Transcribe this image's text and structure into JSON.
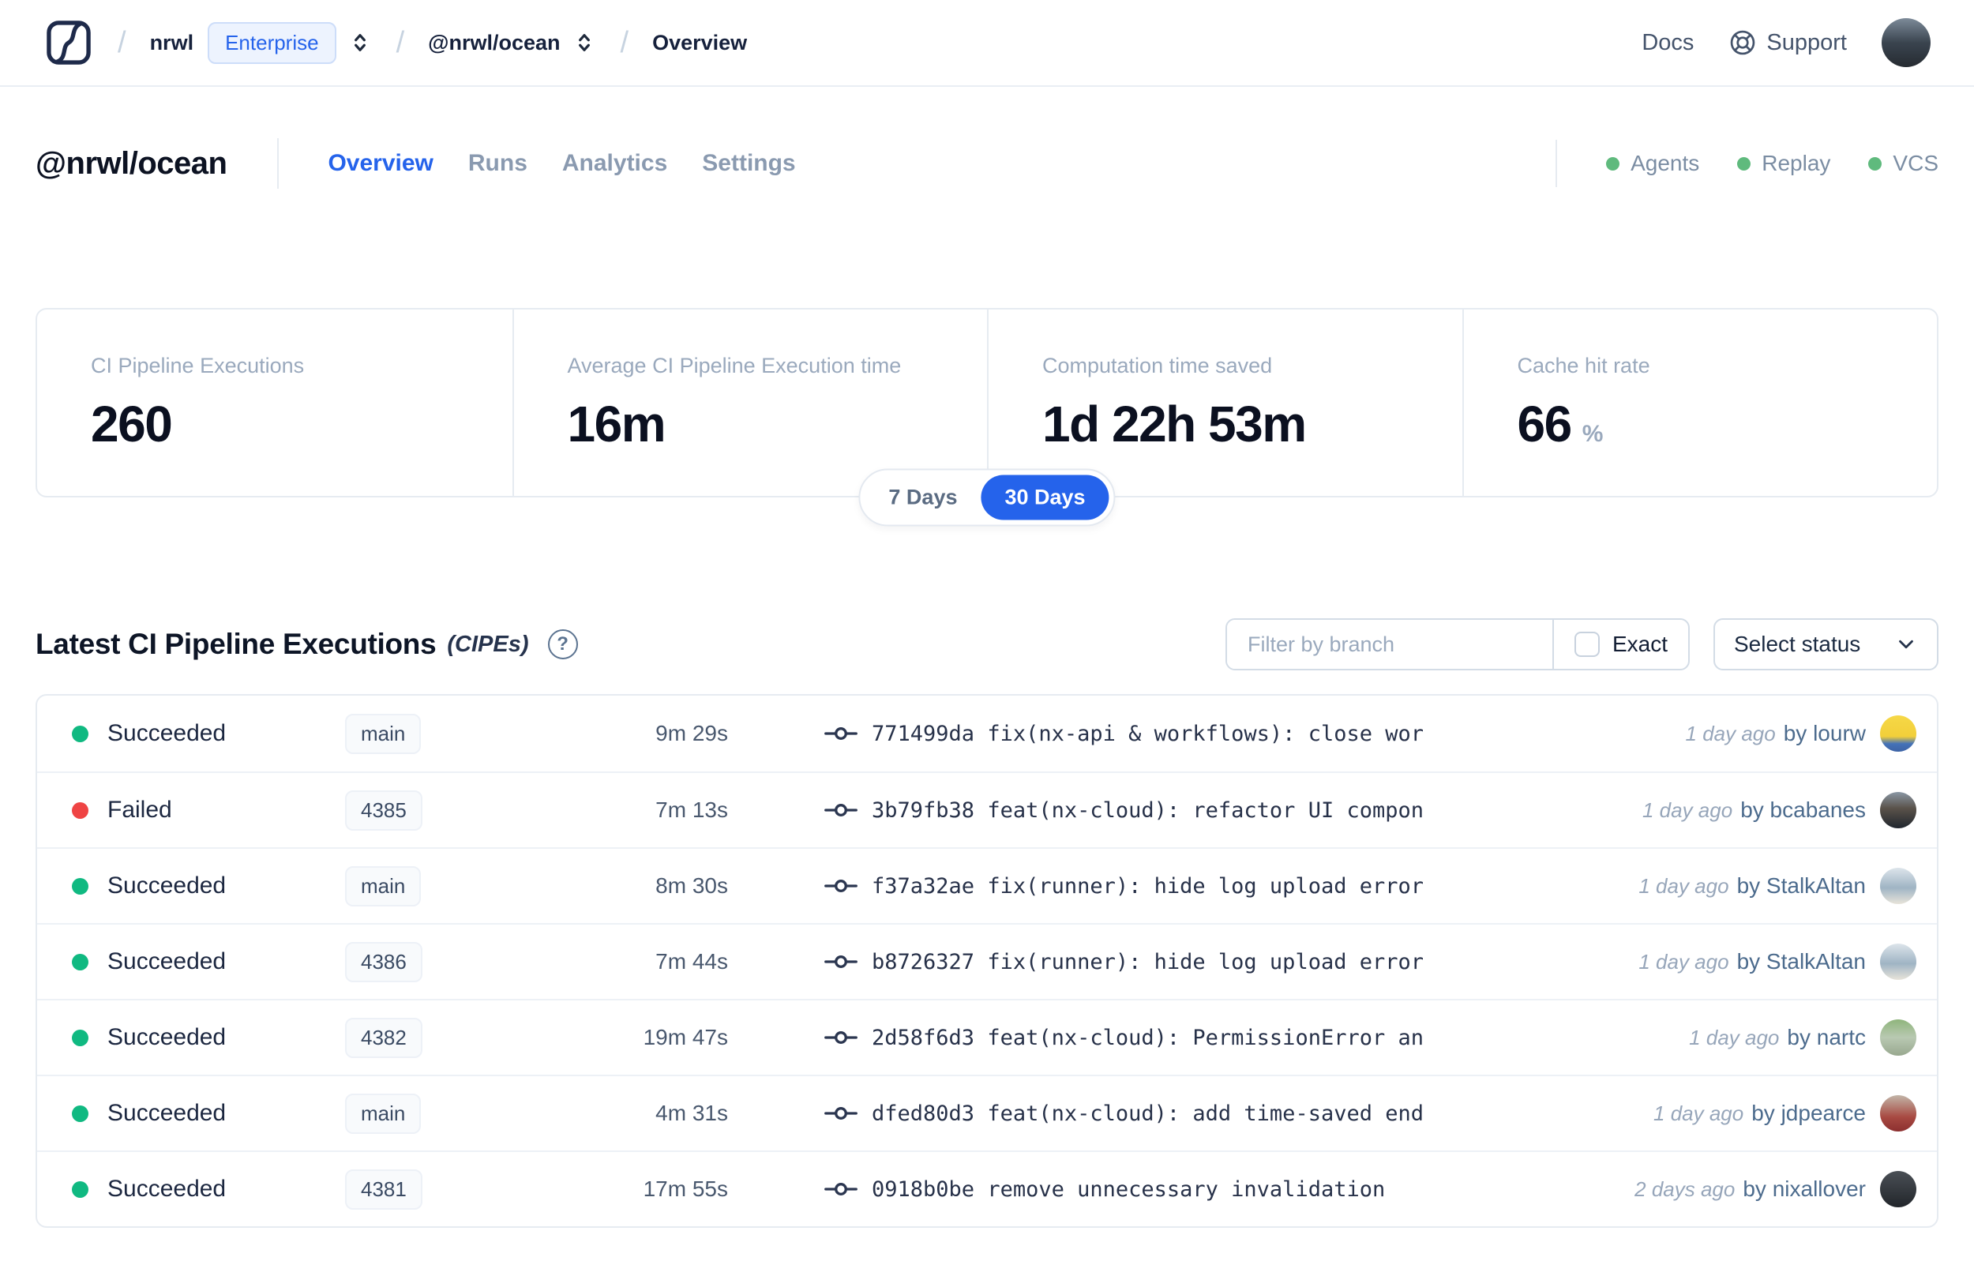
{
  "navbar": {
    "breadcrumb": {
      "org": "nrwl",
      "org_badge": "Enterprise",
      "workspace": "@nrwl/ocean",
      "page": "Overview"
    },
    "docs_label": "Docs",
    "support_label": "Support",
    "avatar_gradient": "linear-gradient(180deg,#7d8b99 0%,#3a444f 50%,#262b31 100%)"
  },
  "header": {
    "title": "@nrwl/ocean",
    "tabs": [
      {
        "label": "Overview",
        "active": true
      },
      {
        "label": "Runs",
        "active": false
      },
      {
        "label": "Analytics",
        "active": false
      },
      {
        "label": "Settings",
        "active": false
      }
    ],
    "services": [
      {
        "label": "Agents"
      },
      {
        "label": "Replay"
      },
      {
        "label": "VCS"
      }
    ],
    "service_dot_color": "#5fba7d"
  },
  "stats": {
    "cards": [
      {
        "label": "CI Pipeline Executions",
        "value": "260",
        "suffix": ""
      },
      {
        "label": "Average CI Pipeline Execution time",
        "value": "16m",
        "suffix": ""
      },
      {
        "label": "Computation time saved",
        "value": "1d 22h 53m",
        "suffix": ""
      },
      {
        "label": "Cache hit rate",
        "value": "66",
        "suffix": "%"
      }
    ],
    "range_toggle": {
      "options": [
        {
          "label": "7 Days"
        },
        {
          "label": "30 Days"
        }
      ],
      "selected": "30 Days"
    }
  },
  "cipe_section": {
    "title": "Latest CI Pipeline Executions",
    "title_suffix": "(CIPEs)",
    "help_glyph": "?",
    "filter": {
      "placeholder": "Filter by branch",
      "value": "",
      "exact_label": "Exact",
      "exact_checked": false
    },
    "status_select_label": "Select status"
  },
  "table": {
    "rows": [
      {
        "status": "Succeeded",
        "dot_color": "#10b981",
        "branch": "main",
        "duration": "9m 29s",
        "hash": "771499da",
        "message": "fix(nx-api & workflows): close workfl…",
        "time_ago": "1 day ago",
        "author": "by lourw",
        "avatar_gradient": "linear-gradient(180deg,#f6d847 0%,#f2cf3a 58%,#4472b8 78%,#3d63a5 100%)"
      },
      {
        "status": "Failed",
        "dot_color": "#ef4444",
        "branch": "4385",
        "duration": "7m 13s",
        "hash": "3b79fb38",
        "message": "feat(nx-cloud): refactor UI component…",
        "time_ago": "1 day ago",
        "author": "by bcabanes",
        "avatar_gradient": "linear-gradient(180deg,#8a97a5 0%,#5a524a 45%,#20262e 100%)"
      },
      {
        "status": "Succeeded",
        "dot_color": "#10b981",
        "branch": "main",
        "duration": "8m 30s",
        "hash": "f37a32ae",
        "message": "fix(runner): hide log upload errors b…",
        "time_ago": "1 day ago",
        "author": "by StalkAltan",
        "avatar_gradient": "linear-gradient(180deg,#dde5eb 0%,#9fb4c4 55%,#e8e4da 100%)"
      },
      {
        "status": "Succeeded",
        "dot_color": "#10b981",
        "branch": "4386",
        "duration": "7m 44s",
        "hash": "b8726327",
        "message": "fix(runner): hide log upload errors b…",
        "time_ago": "1 day ago",
        "author": "by StalkAltan",
        "avatar_gradient": "linear-gradient(180deg,#dde5eb 0%,#9fb4c4 55%,#e8e4da 100%)"
      },
      {
        "status": "Succeeded",
        "dot_color": "#10b981",
        "branch": "4382",
        "duration": "19m 47s",
        "hash": "2d58f6d3",
        "message": "feat(nx-cloud): PermissionError and N…",
        "time_ago": "1 day ago",
        "author": "by nartc",
        "avatar_gradient": "linear-gradient(180deg,#8fb57c 0%,#b9c9b2 50%,#98a88f 100%)"
      },
      {
        "status": "Succeeded",
        "dot_color": "#10b981",
        "branch": "main",
        "duration": "4m 31s",
        "hash": "dfed80d3",
        "message": "feat(nx-cloud): add time-saved end po…",
        "time_ago": "1 day ago",
        "author": "by jdpearce",
        "avatar_gradient": "linear-gradient(180deg,#c2b5a8 0%,#a84a42 60%,#8c2f2f 100%)"
      },
      {
        "status": "Succeeded",
        "dot_color": "#10b981",
        "branch": "4381",
        "duration": "17m 55s",
        "hash": "0918b0be",
        "message": "remove unnecessary invalidation",
        "time_ago": "2 days ago",
        "author": "by nixallover",
        "avatar_gradient": "linear-gradient(180deg,#4a4f55 0%,#22262b 100%)"
      }
    ]
  },
  "colors": {
    "accent_blue": "#2563eb",
    "success_green": "#10b981",
    "failed_red": "#ef4444",
    "header_service_green": "#5fba7d",
    "border": "#e6ebf1"
  }
}
